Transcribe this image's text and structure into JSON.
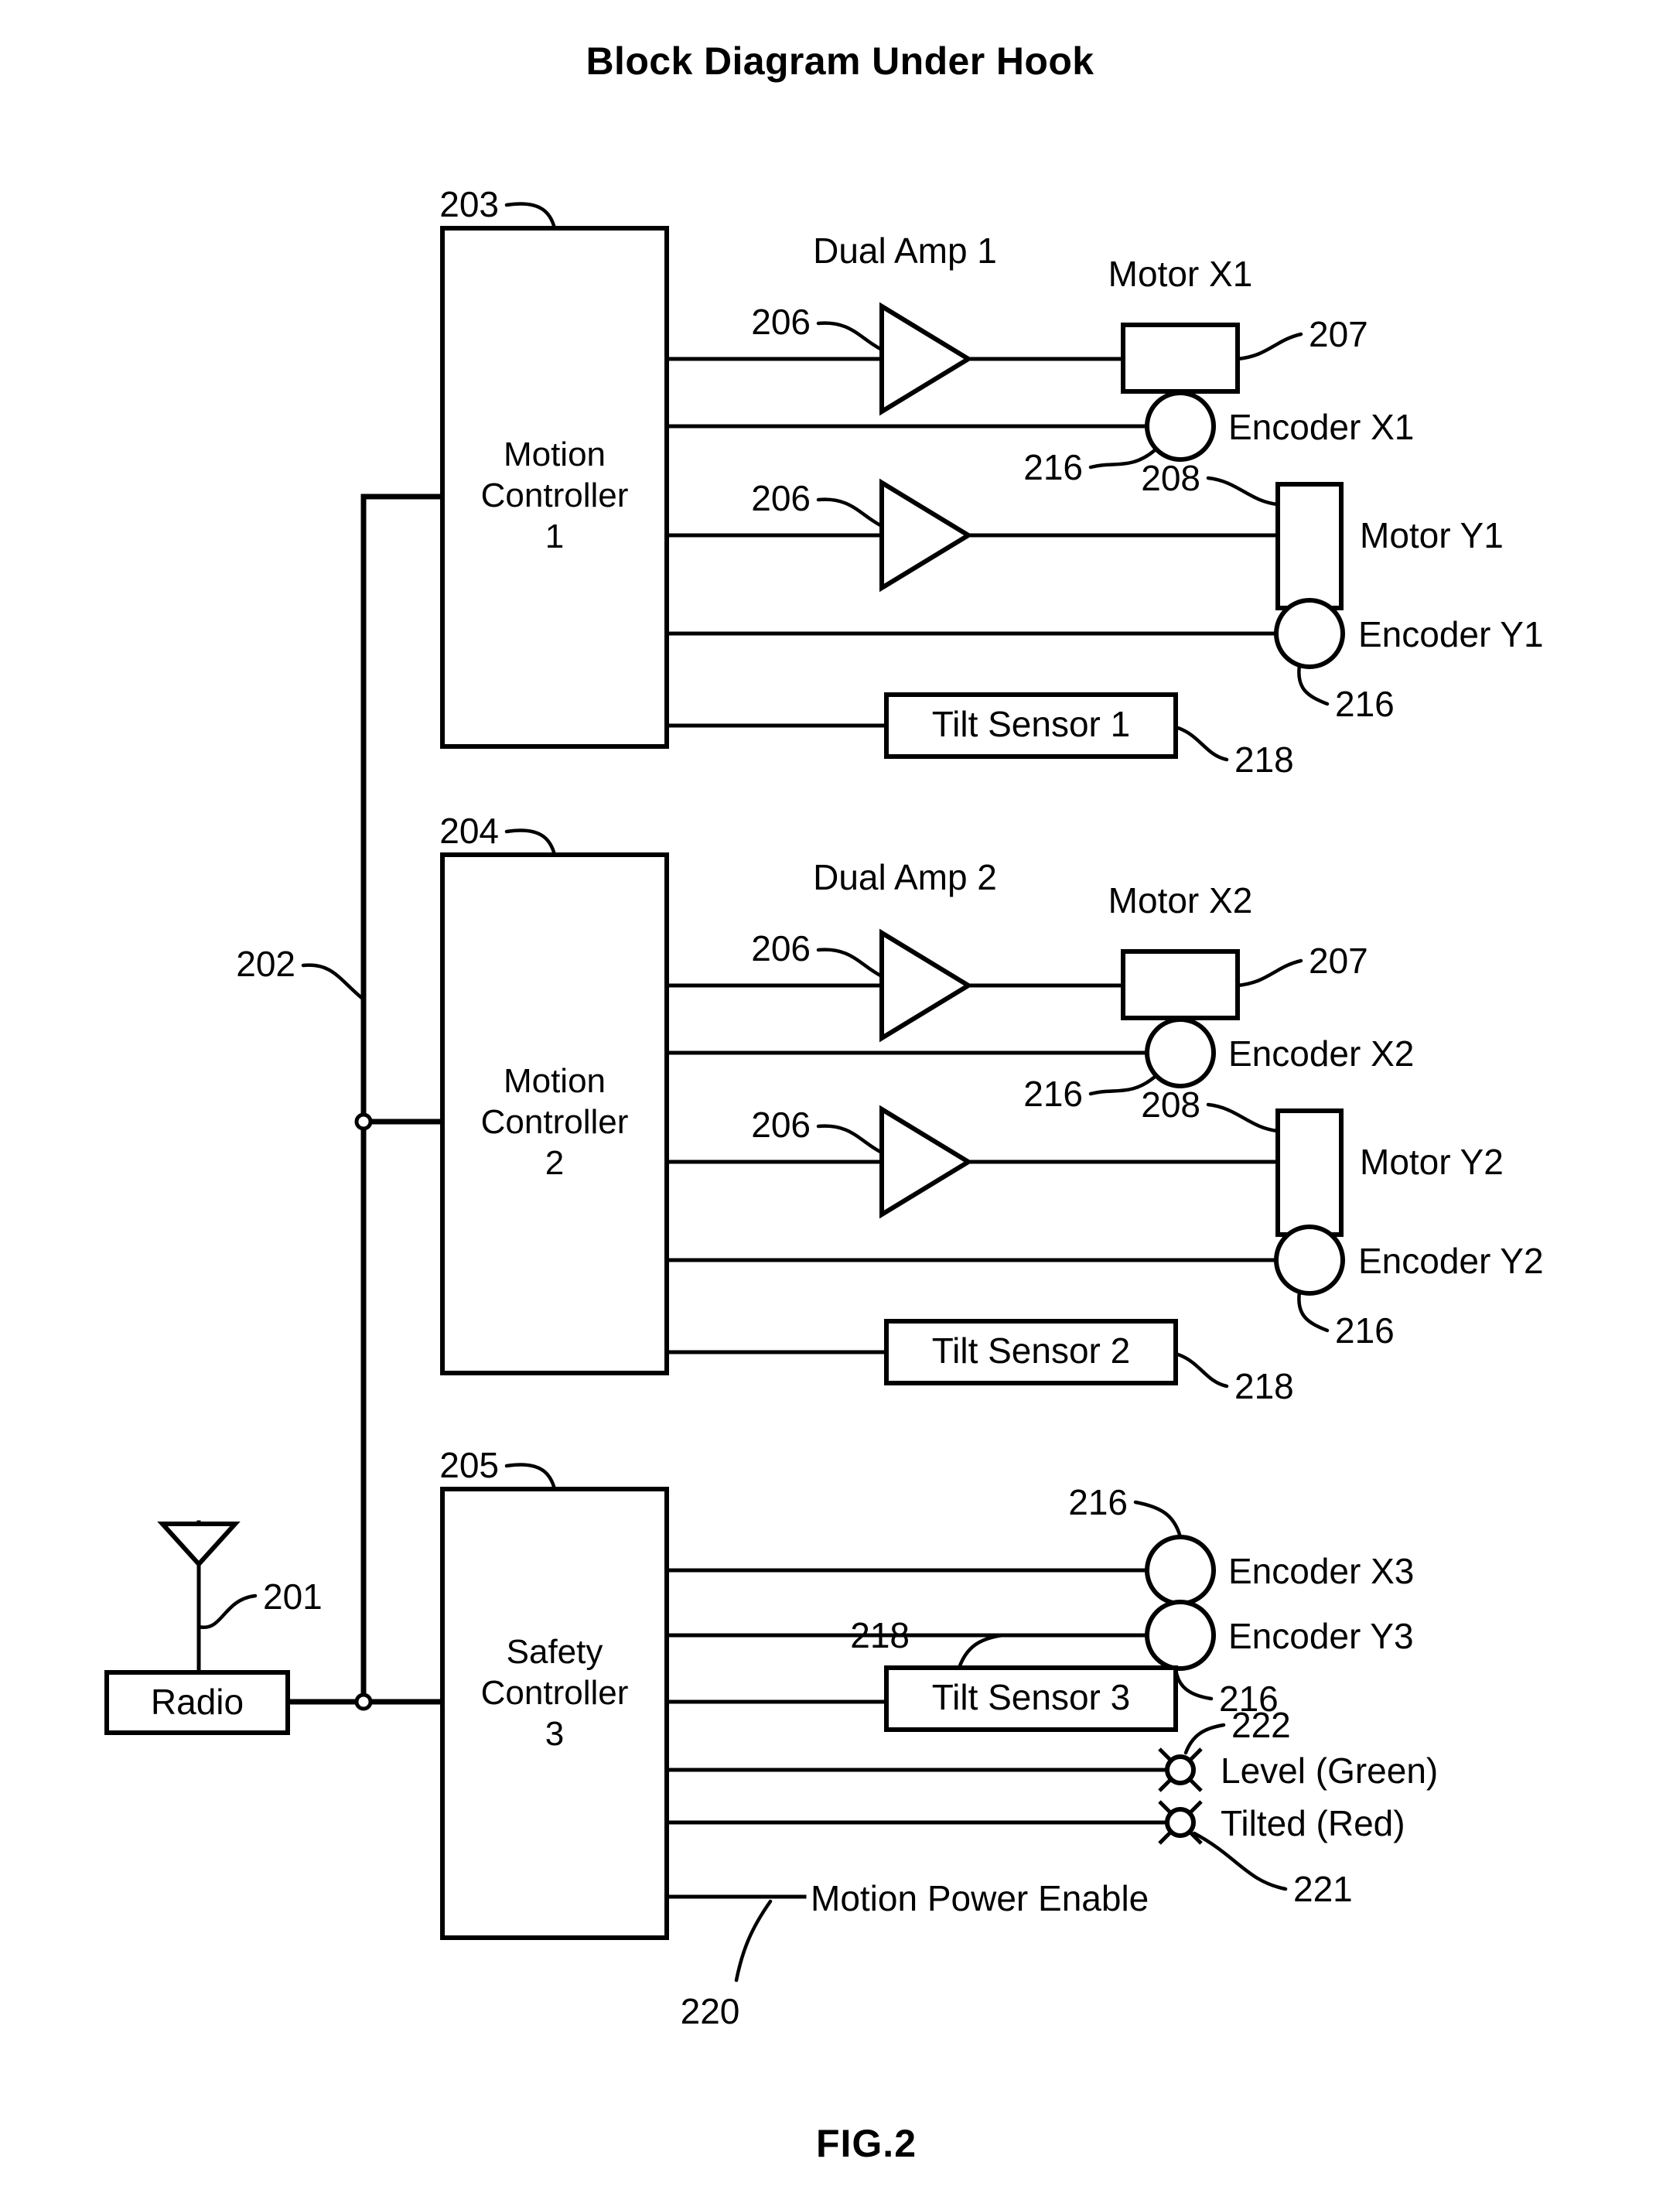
{
  "figure": {
    "title": "Block Diagram Under Hook",
    "caption": "FIG.2"
  },
  "blocks": {
    "radio": {
      "label": "Radio",
      "ref": "201"
    },
    "bus": {
      "ref": "202"
    },
    "motion_controller_1": {
      "line1": "Motion",
      "line2": "Controller",
      "line3": "1",
      "ref": "203"
    },
    "motion_controller_2": {
      "line1": "Motion",
      "line2": "Controller",
      "line3": "2",
      "ref": "204"
    },
    "safety_controller_3": {
      "line1": "Safety",
      "line2": "Controller",
      "line3": "3",
      "ref": "205"
    }
  },
  "channel_1": {
    "amp_title": "Dual Amp 1",
    "amp_x_ref": "206",
    "amp_y_ref": "206",
    "motor_x": {
      "label": "Motor X1",
      "ref": "207"
    },
    "encoder_x": {
      "label": "Encoder X1",
      "ref": "216"
    },
    "motor_y": {
      "label": "Motor Y1",
      "ref": "208"
    },
    "encoder_y": {
      "label": "Encoder Y1",
      "ref": "216"
    },
    "tilt_sensor": {
      "label": "Tilt Sensor 1",
      "ref": "218"
    }
  },
  "channel_2": {
    "amp_title": "Dual Amp 2",
    "amp_x_ref": "206",
    "amp_y_ref": "206",
    "motor_x": {
      "label": "Motor X2",
      "ref": "207"
    },
    "encoder_x": {
      "label": "Encoder X2",
      "ref": "216"
    },
    "motor_y": {
      "label": "Motor Y2",
      "ref": "208"
    },
    "encoder_y": {
      "label": "Encoder Y2",
      "ref": "216"
    },
    "tilt_sensor": {
      "label": "Tilt Sensor 2",
      "ref": "218"
    }
  },
  "channel_3": {
    "encoder_x": {
      "label": "Encoder X3",
      "ref": "216"
    },
    "encoder_y": {
      "label": "Encoder Y3",
      "ref": "216"
    },
    "tilt_sensor": {
      "label": "Tilt Sensor 3",
      "ref": "218"
    },
    "lamp_level": {
      "label": "Level (Green)",
      "ref": "222"
    },
    "lamp_tilted": {
      "label": "Tilted (Red)",
      "ref": "221"
    },
    "motion_power_enable": {
      "label": "Motion Power Enable",
      "ref": "220"
    }
  },
  "colors": {
    "ink": "#000000",
    "paper": "#ffffff"
  }
}
